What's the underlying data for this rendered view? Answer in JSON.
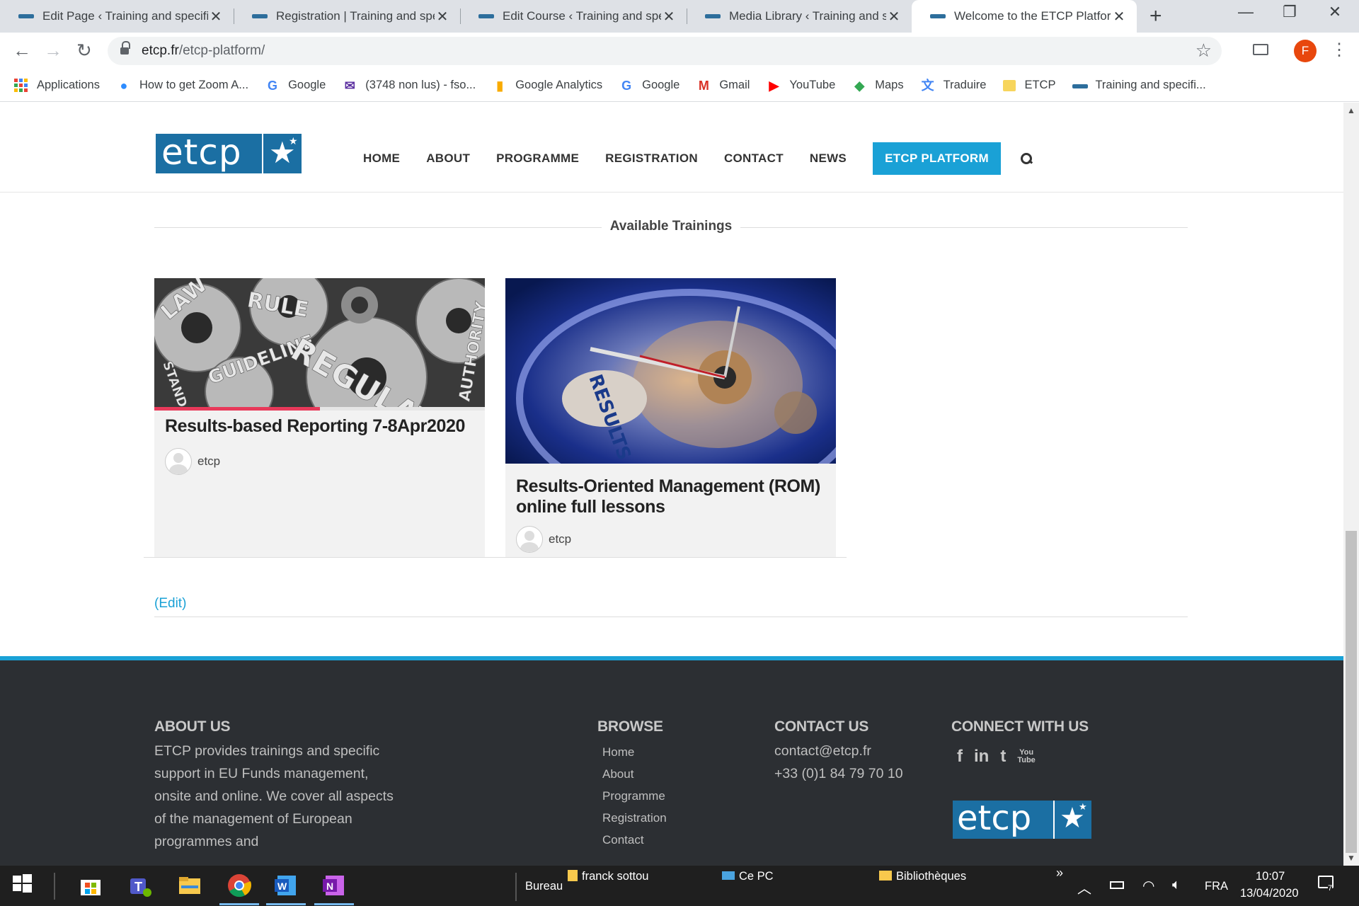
{
  "browser": {
    "tabs": [
      {
        "title": "Edit Page ‹ Training and specifi",
        "active": false
      },
      {
        "title": "Registration | Training and spec",
        "active": false
      },
      {
        "title": "Edit Course ‹ Training and spec",
        "active": false
      },
      {
        "title": "Media Library ‹ Training and sp",
        "active": false
      },
      {
        "title": "Welcome to the ETCP Platform",
        "active": true
      }
    ],
    "url_host": "etcp.fr",
    "url_path": "/etcp-platform/",
    "profile_initial": "F",
    "bookmarks": [
      {
        "label": "Applications",
        "icon": "apps-grid-icon"
      },
      {
        "label": "How to get Zoom A...",
        "icon": "zoom-icon"
      },
      {
        "label": "Google",
        "icon": "google-icon"
      },
      {
        "label": "(3748 non lus) - fso...",
        "icon": "mail-icon"
      },
      {
        "label": "Google Analytics",
        "icon": "analytics-icon"
      },
      {
        "label": "Google",
        "icon": "google-icon"
      },
      {
        "label": "Gmail",
        "icon": "gmail-icon"
      },
      {
        "label": "YouTube",
        "icon": "youtube-icon"
      },
      {
        "label": "Maps",
        "icon": "maps-icon"
      },
      {
        "label": "Traduire",
        "icon": "translate-icon"
      },
      {
        "label": "ETCP",
        "icon": "folder-icon"
      },
      {
        "label": "Training and specifi...",
        "icon": "site-icon"
      }
    ]
  },
  "site": {
    "logo_text": "etcp",
    "nav": [
      "HOME",
      "ABOUT",
      "PROGRAMME",
      "REGISTRATION",
      "CONTACT",
      "NEWS"
    ],
    "nav_cta": "ETCP PLATFORM",
    "section_title": "Available Trainings",
    "courses": [
      {
        "title": "Results-based Reporting 7-8Apr2020",
        "author": "etcp",
        "image_words": [
          "LAW",
          "RULE",
          "STANDARD",
          "GUIDELINE",
          "REGULATION",
          "AUTHORITY"
        ],
        "progress_pct": 50
      },
      {
        "title": "Results-Oriented Management (ROM) online full lessons",
        "author": "etcp",
        "image_words": [
          "RESULTS"
        ]
      }
    ],
    "edit_link": "(Edit)",
    "accent_color": "#1aa1d6",
    "brand_color": "#1b6fa3"
  },
  "footer": {
    "about_title": "ABOUT US",
    "about_text": "ETCP provides trainings and specific support in EU Funds management, onsite and online. We cover all aspects of the management of European programmes and",
    "browse_title": "BROWSE",
    "browse_links": [
      "Home",
      "About",
      "Programme",
      "Registration",
      "Contact"
    ],
    "contact_title": "CONTACT US",
    "contact_email": "contact@etcp.fr",
    "contact_phone": "+33 (0)1 84 79 70 10",
    "connect_title": "CONNECT WITH US",
    "social": [
      "facebook-icon",
      "linkedin-icon",
      "twitter-icon",
      "youtube-icon"
    ],
    "logo_text": "etcp"
  },
  "taskbar": {
    "toolbar_label": "Bureau",
    "pinned_folders": [
      "franck sottou",
      "Ce PC",
      "Bibliothèques"
    ],
    "language": "FRA",
    "time": "10:07",
    "date": "13/04/2020",
    "notification_count": "7"
  }
}
